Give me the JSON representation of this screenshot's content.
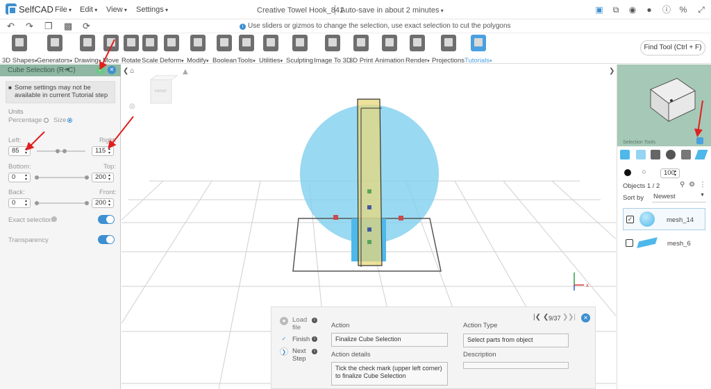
{
  "app": {
    "name": "SelfCAD"
  },
  "menu": {
    "file": "File",
    "edit": "Edit",
    "view": "View",
    "settings": "Settings"
  },
  "document": {
    "title": "Creative Towel Hook_841",
    "autosave": "Auto-save in about 2 minutes"
  },
  "hint": {
    "text": "Use sliders or gizmos to change the selection, use exact selection to cut the polygons"
  },
  "toolbar": {
    "tools": [
      "3D Shapes",
      "Generators",
      "Drawing",
      "Move",
      "Rotate",
      "Scale",
      "Deform",
      "Modify",
      "Boolean",
      "Tools",
      "Utilities",
      "Sculpting",
      "Image To 3D",
      "3D Print",
      "Animation",
      "Render",
      "Projections",
      "Tutorials"
    ],
    "find_tool": "Find Tool (Ctrl + F)"
  },
  "left_panel": {
    "title": "Cube Selection (R+C)",
    "warning": "Some settings may not be available in current Tutorial step",
    "units_label": "Units",
    "percentage_label": "Percentage",
    "size_label": "Size",
    "left_label": "Left:",
    "right_label": "Right:",
    "left_value": "85",
    "right_value": "115",
    "bottom_label": "Bottom:",
    "top_label": "Top:",
    "bottom_value": "0",
    "top_value": "200",
    "back_label": "Back:",
    "front_label": "Front:",
    "back_value": "0",
    "front_value": "200",
    "exact_selection_label": "Exact selection",
    "transparency_label": "Transparency"
  },
  "viewcube": {
    "face_label": "FRONT"
  },
  "right_panel": {
    "selection_tools_label": "Selection Tools",
    "opacity_value": "100",
    "objects_label": "Objects 1 / 2",
    "sort_label": "Sort by",
    "sort_value": "Newest",
    "objects": [
      {
        "name": "mesh_14",
        "checked": true,
        "color": "#4fb8ea"
      },
      {
        "name": "mesh_6",
        "checked": false,
        "color": "#4fb8ea"
      }
    ]
  },
  "tutorial": {
    "steps": [
      {
        "label": "Load file"
      },
      {
        "label": "Finish"
      },
      {
        "label": "Next Step"
      }
    ],
    "page": "9/37",
    "action_label": "Action",
    "action_value": "Finalize Cube Selection",
    "action_details_label": "Action details",
    "action_details_value": "Tick the check mark (upper left corner) to finalize Cube Selection",
    "action_type_label": "Action Type",
    "action_type_value": "Select parts from object",
    "description_label": "Description",
    "description_value": ""
  },
  "colors": {
    "accent": "#3d8fd1",
    "panel_header": "#8fb7a3",
    "sphere": "#7fd0ee",
    "selection_box": "#e8d77a",
    "arrow": "#e02020"
  }
}
